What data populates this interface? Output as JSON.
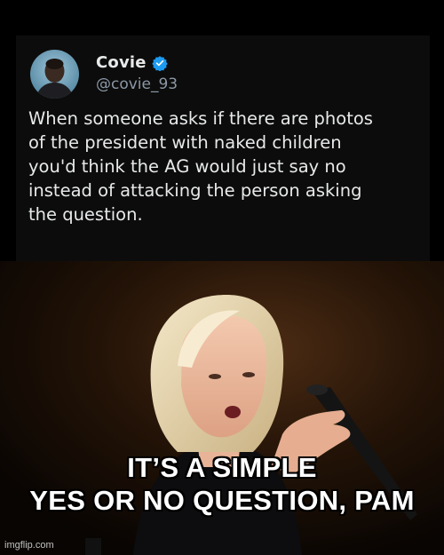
{
  "tweet": {
    "display_name": "Covie",
    "verified_icon": "verified-badge-icon",
    "handle": "@covie_93",
    "text": "When someone asks if there are photos\nof the president with naked children\nyou'd think the AG would just say no\ninstead of attacking the person asking\nthe question."
  },
  "meme": {
    "caption_line_1": "IT’S A SIMPLE",
    "caption_line_2": "YES OR NO QUESTION, PAM"
  },
  "watermark": "imgflip.com",
  "colors": {
    "background": "#000000",
    "tweet_background": "#0c0c0c",
    "primary_text": "#e7e9ea",
    "secondary_text": "#8b98a5",
    "verified_blue": "#1d9bf0",
    "caption_text": "#ffffff"
  }
}
